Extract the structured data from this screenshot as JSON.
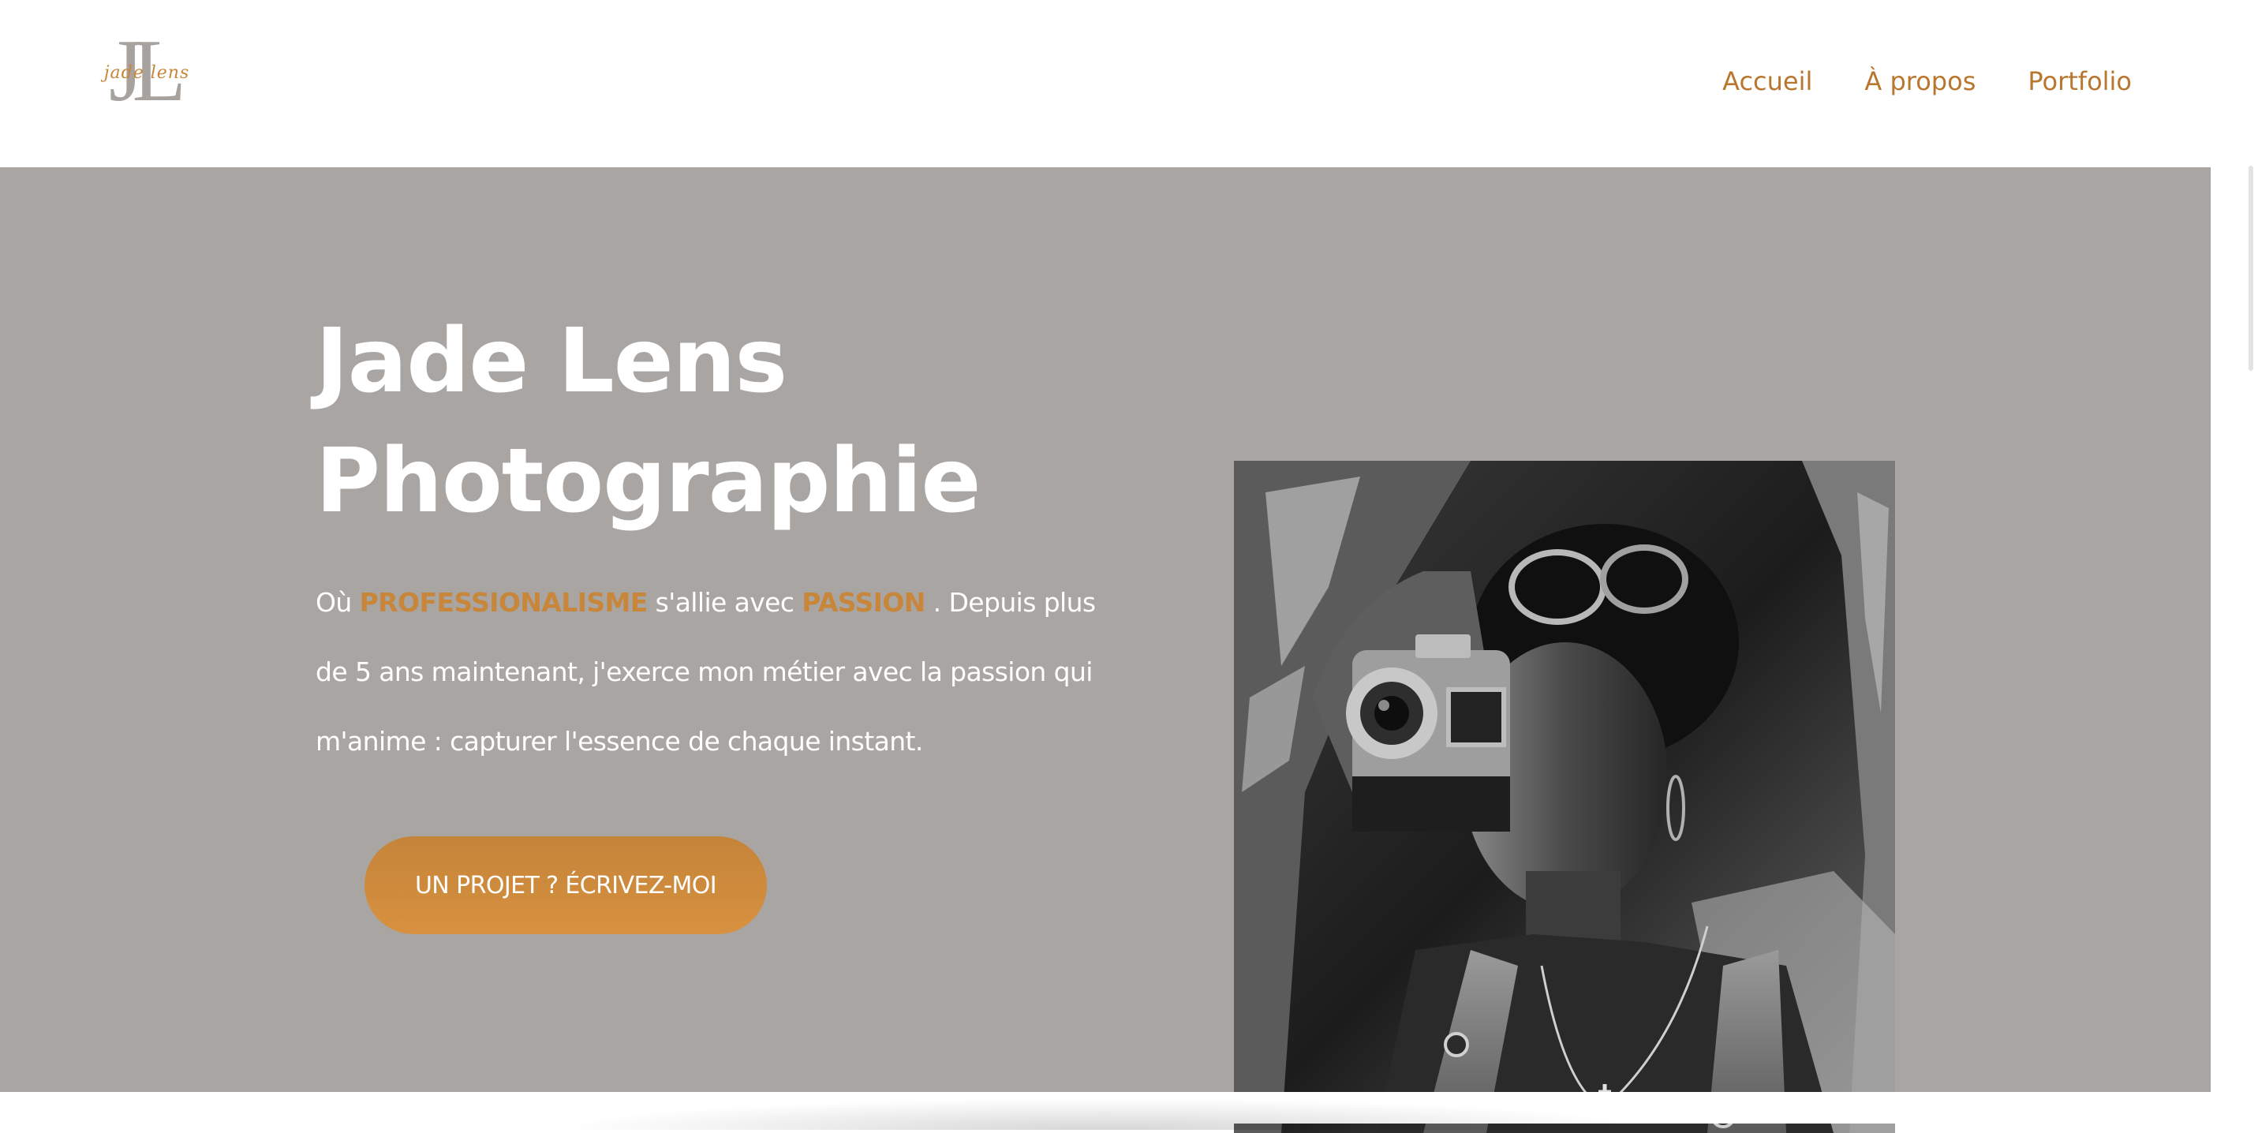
{
  "header": {
    "logo": {
      "monogram": "JL",
      "script": "jade lens"
    },
    "nav": [
      "Accueil",
      "À propos",
      "Portfolio"
    ]
  },
  "hero": {
    "title_line1": "Jade Lens",
    "title_line2": "Photographie",
    "text": {
      "pre": "Où ",
      "highlight1": "PROFESSIONALISME",
      "mid": " s'allie avec ",
      "highlight2": "PASSION",
      "post": " . Depuis plus de 5 ans maintenant, j'exerce mon métier avec la passion qui m'anime : capturer l'essence de chaque instant."
    },
    "cta": "UN PROJET ? ÉCRIVEZ-MOI"
  },
  "colors": {
    "accent": "#c8863a",
    "nav": "#b8762e",
    "hero_background": "#a9a5a2",
    "logo_gray": "#a8a29f"
  },
  "icons": [
    "jade-lens-logo"
  ]
}
